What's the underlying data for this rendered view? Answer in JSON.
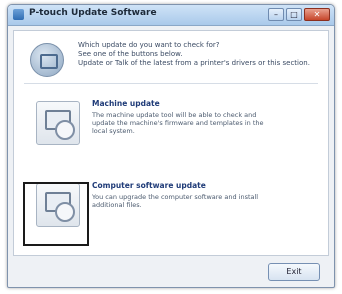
{
  "window": {
    "title": "P-touch Update Software",
    "controls": {
      "minimize": "–",
      "maximize": "□",
      "close": "✕"
    }
  },
  "header": {
    "icon": "update-globe-icon",
    "text": "Which update do you want to check for?\nSee one of the buttons below.\nUpdate or Talk of the latest from a printer's drivers or this section."
  },
  "options": [
    {
      "title": "Machine update",
      "description": "The machine update tool will be able to check and update the machine's firmware and templates in the local system.",
      "icon": "machine-update-icon"
    },
    {
      "title": "Computer software update",
      "description": "You can upgrade the computer software and install additional files.",
      "icon": "computer-software-update-icon"
    }
  ],
  "footer": {
    "exit_label": "Exit"
  },
  "colors": {
    "accent": "#1f3b78",
    "highlight": "#1a1a1a",
    "title_bar": "#a9c9ea"
  }
}
